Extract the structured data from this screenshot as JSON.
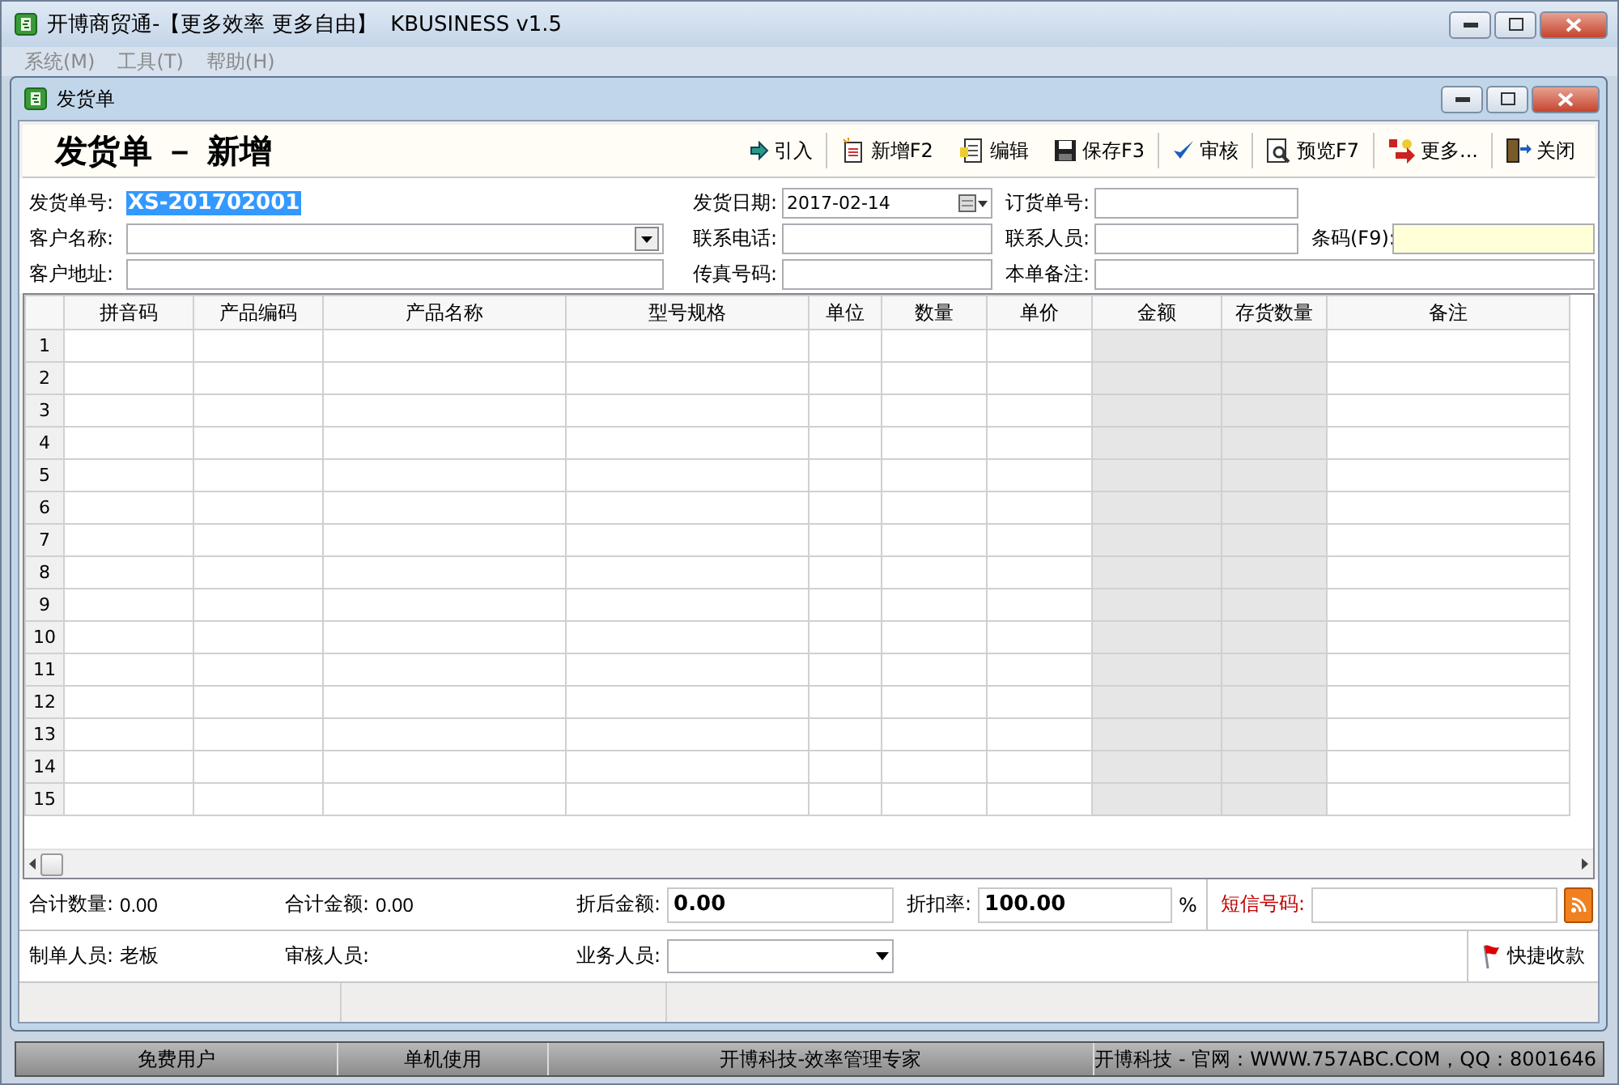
{
  "window": {
    "title": "开博商贸通-【更多效率 更多自由】  KBUSINESS v1.5"
  },
  "menu": [
    "系统(M)",
    "工具(T)",
    "帮助(H)"
  ],
  "child_window": {
    "title": "发货单"
  },
  "header": {
    "title": "发货单 － 新增"
  },
  "toolbar": [
    {
      "label": "引入",
      "kind": "import"
    },
    {
      "label": "新增F2",
      "kind": "new"
    },
    {
      "label": "编辑",
      "kind": "edit"
    },
    {
      "label": "保存F3",
      "kind": "save"
    },
    {
      "label": "审核",
      "kind": "approve"
    },
    {
      "label": "预览F7",
      "kind": "preview"
    },
    {
      "label": "更多...",
      "kind": "more"
    },
    {
      "label": "关闭",
      "kind": "close"
    }
  ],
  "form": [
    [
      {
        "label": "发货单号:",
        "value": "XS-201702001",
        "kind": "selected"
      },
      {
        "label": "发货日期:",
        "value": "2017-02-14",
        "kind": "date"
      },
      {
        "label": "订货单号:",
        "kind": "text"
      }
    ],
    [
      {
        "label": "客户名称:",
        "kind": "combo"
      },
      {
        "label": "联系电话:",
        "kind": "text"
      },
      {
        "label": "联系人员:",
        "kind": "text"
      },
      {
        "label": "条码(F9):",
        "kind": "barcode"
      }
    ],
    [
      {
        "label": "客户地址:",
        "kind": "text"
      },
      {
        "label": "传真号码:",
        "kind": "text"
      },
      {
        "label": "本单备注:",
        "kind": "wide"
      }
    ]
  ],
  "table": {
    "columns": [
      {
        "label": "拼音码",
        "readonly": false
      },
      {
        "label": "产品编码",
        "readonly": false
      },
      {
        "label": "产品名称",
        "readonly": false
      },
      {
        "label": "型号规格",
        "readonly": false
      },
      {
        "label": "单位",
        "readonly": false
      },
      {
        "label": "数量",
        "readonly": false
      },
      {
        "label": "单价",
        "readonly": false
      },
      {
        "label": "金额",
        "readonly": true
      },
      {
        "label": "存货数量",
        "readonly": true
      },
      {
        "label": "备注",
        "readonly": false
      }
    ],
    "rows": [
      "1",
      "2",
      "3",
      "4",
      "5",
      "6",
      "7",
      "8",
      "9",
      "10",
      "11",
      "12",
      "13",
      "14",
      "15"
    ]
  },
  "summary": {
    "total_qty_label": "合计数量:",
    "total_qty": "0.00",
    "total_amount_label": "合计金额:",
    "total_amount": "0.00",
    "discounted_label": "折后金额:",
    "discounted": "0.00",
    "discount_rate_label": "折扣率:",
    "discount_rate": "100.00",
    "percent": "%",
    "sms_label": "短信号码:"
  },
  "people": {
    "creator_label": "制单人员:",
    "creator": "老板",
    "reviewer_label": "审核人员:",
    "sales_label": "业务人员:",
    "quick_pay": "快捷收款"
  },
  "status_bar": [
    "免费用户",
    "单机使用",
    "开博科技-效率管理专家",
    "开博科技 - 官网：WWW.757ABC.COM，QQ：8001646"
  ]
}
